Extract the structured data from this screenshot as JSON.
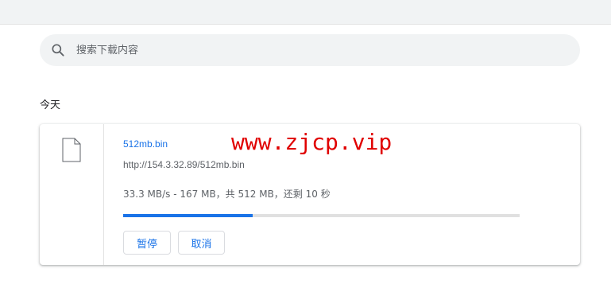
{
  "search": {
    "placeholder": "搜索下载内容"
  },
  "section": {
    "title": "今天"
  },
  "download": {
    "file_name": "512mb.bin",
    "url": "http://154.3.32.89/512mb.bin",
    "status": "33.3 MB/s - 167 MB，共 512 MB，还剩 10 秒",
    "progress_fraction": 0.326,
    "buttons": {
      "pause": "暂停",
      "cancel": "取消"
    },
    "icon": "file-icon"
  },
  "watermark": {
    "text": "www.zjcp.vip"
  },
  "colors": {
    "accent": "#1a73e8",
    "watermark": "#e00000",
    "toolbar_bg": "#f1f3f4"
  }
}
